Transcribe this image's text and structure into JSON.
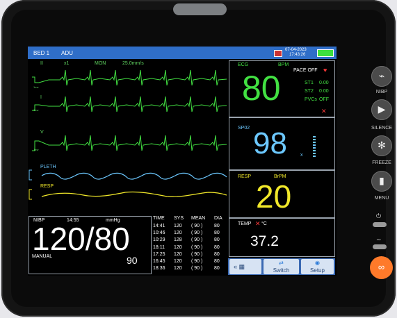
{
  "header": {
    "bed": "BED  1",
    "patient_type": "ADU",
    "date": "07-04-2023",
    "time": "17:43:26"
  },
  "waves": {
    "ecg1": {
      "lead": "II",
      "gain": "x1",
      "mode": "MON",
      "speed": "25.0mm/s",
      "cal": "1mv"
    },
    "ecg2": {
      "lead": "I",
      "cal": "1mv"
    },
    "ecg3": {
      "lead": "V",
      "cal": "1mv"
    },
    "pleth": {
      "label": "PLETH"
    },
    "resp": {
      "label": "RESP"
    }
  },
  "ecg": {
    "label": "ECG",
    "unit": "BPM",
    "value": "80",
    "pace": "PACE OFF",
    "st1_label": "ST1",
    "st1": "0.00",
    "st2_label": "ST2",
    "st2": "0.00",
    "pvcs_label": "PVCs",
    "pvcs": "OFF"
  },
  "spo2": {
    "label": "SP02",
    "value": "98",
    "suffix": "x"
  },
  "resp": {
    "label": "RESP",
    "unit": "BrPM",
    "value": "20"
  },
  "temp": {
    "label": "TEMP",
    "unit": "°C",
    "value": "37.2"
  },
  "nibp": {
    "label": "NIBP",
    "time": "14:55",
    "unit": "mmHg",
    "value": "120/80",
    "mode": "MANUAL",
    "mean": "90"
  },
  "trend": {
    "headers": [
      "TIME",
      "SYS",
      "MEAN",
      "DIA"
    ],
    "rows": [
      [
        "14:41",
        "120",
        "( 90 )",
        "80"
      ],
      [
        "10:46",
        "120",
        "( 90 )",
        "80"
      ],
      [
        "10:29",
        "128",
        "( 90 )",
        "80"
      ],
      [
        "18:11",
        "120",
        "( 90 )",
        "80"
      ],
      [
        "17:25",
        "120",
        "( 90 )",
        "80"
      ],
      [
        "16:45",
        "120",
        "( 90 )",
        "80"
      ],
      [
        "18:36",
        "120",
        "( 90 )",
        "80"
      ]
    ]
  },
  "bottom": {
    "switch": "Switch",
    "setup": "Setup"
  },
  "side_buttons": {
    "nibp": "NIBP",
    "silence": "SILENCE",
    "freeze": "FREEZE",
    "menu": "MENU"
  },
  "colors": {
    "ecg": "#42e042",
    "spo2": "#6cc8ff",
    "resp": "#f1e82a",
    "alarm": "#ff7a2a"
  }
}
